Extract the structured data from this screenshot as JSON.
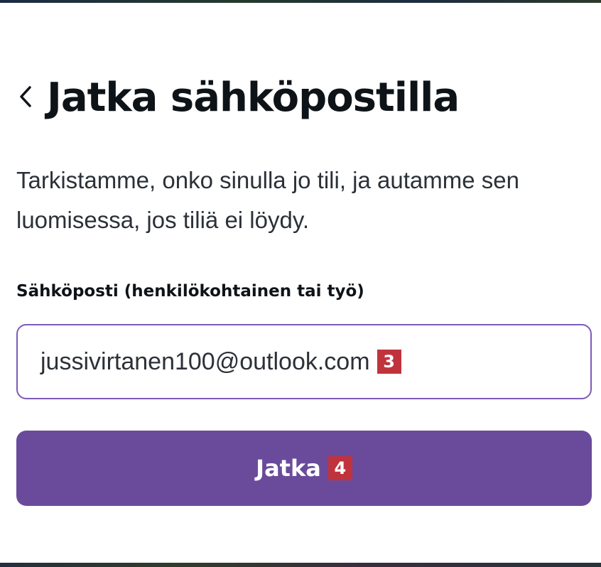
{
  "dialog": {
    "back_icon": "chevron-left-icon",
    "title": "Jatka sähköpostilla",
    "description": "Tarkistamme, onko sinulla jo tili, ja autamme sen luomisessa, jos tiliä ei löydy.",
    "email_label": "Sähköposti (henkilökohtainen tai työ)",
    "email_value": "jussivirtanen100@outlook.com",
    "email_marker": "3",
    "continue_label": "Jatka",
    "continue_marker": "4"
  },
  "colors": {
    "accent": "#6a4b9b",
    "input_border": "#7d5bb8",
    "marker": "#c0333d",
    "text": "#0e1318"
  }
}
